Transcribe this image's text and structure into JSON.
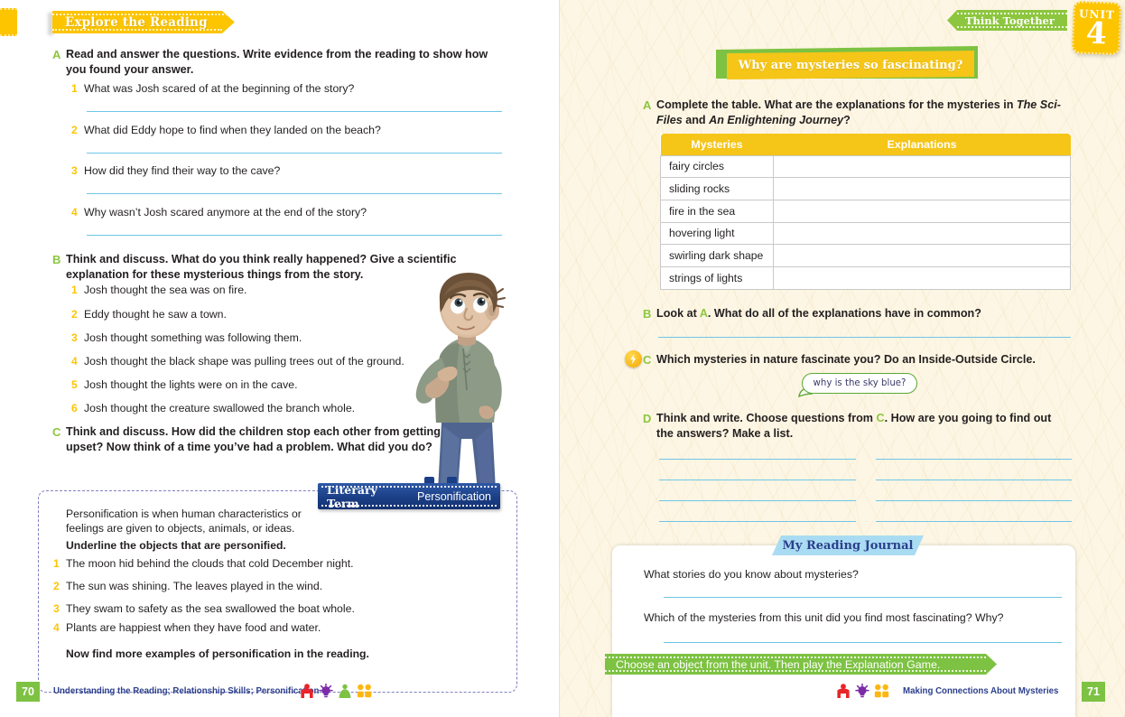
{
  "left_page": {
    "banner": "Explore the Reading",
    "section_a": {
      "letter": "A",
      "instruction": "Read and answer the questions. Write evidence from the reading to show how you found your answer.",
      "questions": [
        {
          "num": "1",
          "text": "What was Josh scared of at the beginning of the story?"
        },
        {
          "num": "2",
          "text": "What did Eddy hope to find when they landed on the beach?"
        },
        {
          "num": "3",
          "text": "How did they find their way to the cave?"
        },
        {
          "num": "4",
          "text": "Why wasn’t Josh scared anymore at the end of the story?"
        }
      ]
    },
    "section_b": {
      "letter": "B",
      "instruction": "Think and discuss. What do you think really happened? Give a scientific explanation for these mysterious things from the story.",
      "items": [
        {
          "num": "1",
          "text": "Josh thought the sea was on fire."
        },
        {
          "num": "2",
          "text": "Eddy thought he saw a town."
        },
        {
          "num": "3",
          "text": "Josh thought something was following them."
        },
        {
          "num": "4",
          "text": "Josh thought the black shape was pulling trees out of the ground."
        },
        {
          "num": "5",
          "text": "Josh thought the lights were on in the cave."
        },
        {
          "num": "6",
          "text": "Josh thought the creature swallowed the branch whole."
        }
      ]
    },
    "section_c": {
      "letter": "C",
      "instruction": "Think and discuss. How did the children stop each other from getting upset? Now think of a time you’ve had a problem. What did you do?"
    },
    "literary_term": {
      "tab_title": "Literary Term",
      "tab_word": "Personification",
      "definition": "Personification is when human characteristics or feelings are given to objects, animals, or ideas.",
      "task": "Underline the objects that are personified.",
      "items": [
        {
          "num": "1",
          "text": "The moon hid behind the clouds that cold December night."
        },
        {
          "num": "2",
          "text": "The sun was shining. The leaves played in the wind."
        },
        {
          "num": "3",
          "text": "They swam to safety as the sea swallowed the boat whole."
        },
        {
          "num": "4",
          "text": "Plants are happiest when they have food and water."
        }
      ],
      "closing": "Now find more examples of personification in the reading."
    },
    "footer": {
      "page_number": "70",
      "text": "Understanding the Reading; Relationship Skills; Personification",
      "icons": [
        "person-red-icon",
        "lightbulb-purple-icon",
        "person-green-icon",
        "binoculars-orange-icon"
      ]
    }
  },
  "right_page": {
    "banner_think": "Think Together",
    "unit": {
      "word": "UNIT",
      "number": "4"
    },
    "banner_why": "Why are mysteries so fascinating?",
    "section_a": {
      "letter": "A",
      "instruction_part1": "Complete the table. What are the explanations for the mysteries in ",
      "instruction_italic1": "The Sci-Files",
      "instruction_part2": " and ",
      "instruction_italic2": "An Enlightening Journey",
      "instruction_part3": "?"
    },
    "table": {
      "headers": [
        "Mysteries",
        "Explanations"
      ],
      "rows": [
        {
          "mystery": "fairy circles",
          "explanation": ""
        },
        {
          "mystery": "sliding rocks",
          "explanation": ""
        },
        {
          "mystery": "fire in the sea",
          "explanation": ""
        },
        {
          "mystery": "hovering light",
          "explanation": ""
        },
        {
          "mystery": "swirling dark shape",
          "explanation": ""
        },
        {
          "mystery": "strings of lights",
          "explanation": ""
        }
      ]
    },
    "section_b": {
      "letter": "B",
      "text_before": "Look at ",
      "ref": "A",
      "text_after": ". What do all of the explanations have in common?"
    },
    "section_c": {
      "letter": "C",
      "instruction": "Which mysteries in nature fascinate you? Do an Inside-Outside Circle.",
      "bubble_text": "why is the sky blue?",
      "badge_icon": "lightning-badge-icon"
    },
    "section_d": {
      "letter": "D",
      "text_before": "Think and write. Choose questions from ",
      "ref": "C",
      "text_after": ". How are you going to find out the answers? Make a list."
    },
    "journal": {
      "tab": "My Reading Journal",
      "questions": [
        "What stories do you know about mysteries?",
        "Which of the mysteries from this unit did you find most fascinating? Why?"
      ]
    },
    "green_strip": "Choose an object from the unit. Then play the Explanation Game.",
    "footer": {
      "page_number": "71",
      "text": "Making Connections About Mysteries",
      "icons": [
        "person-red-icon",
        "lightbulb-purple-icon",
        "binoculars-orange-icon"
      ]
    }
  },
  "colors": {
    "yellow": "#fdc400",
    "gold": "#f5c518",
    "green": "#7dc242",
    "light_green": "#8cc63e",
    "blue_navy": "#2b3f8c",
    "rule_blue": "#6ec6e8",
    "journal_blue": "#a9dcf2",
    "paper_cream": "#fdf6e4"
  }
}
